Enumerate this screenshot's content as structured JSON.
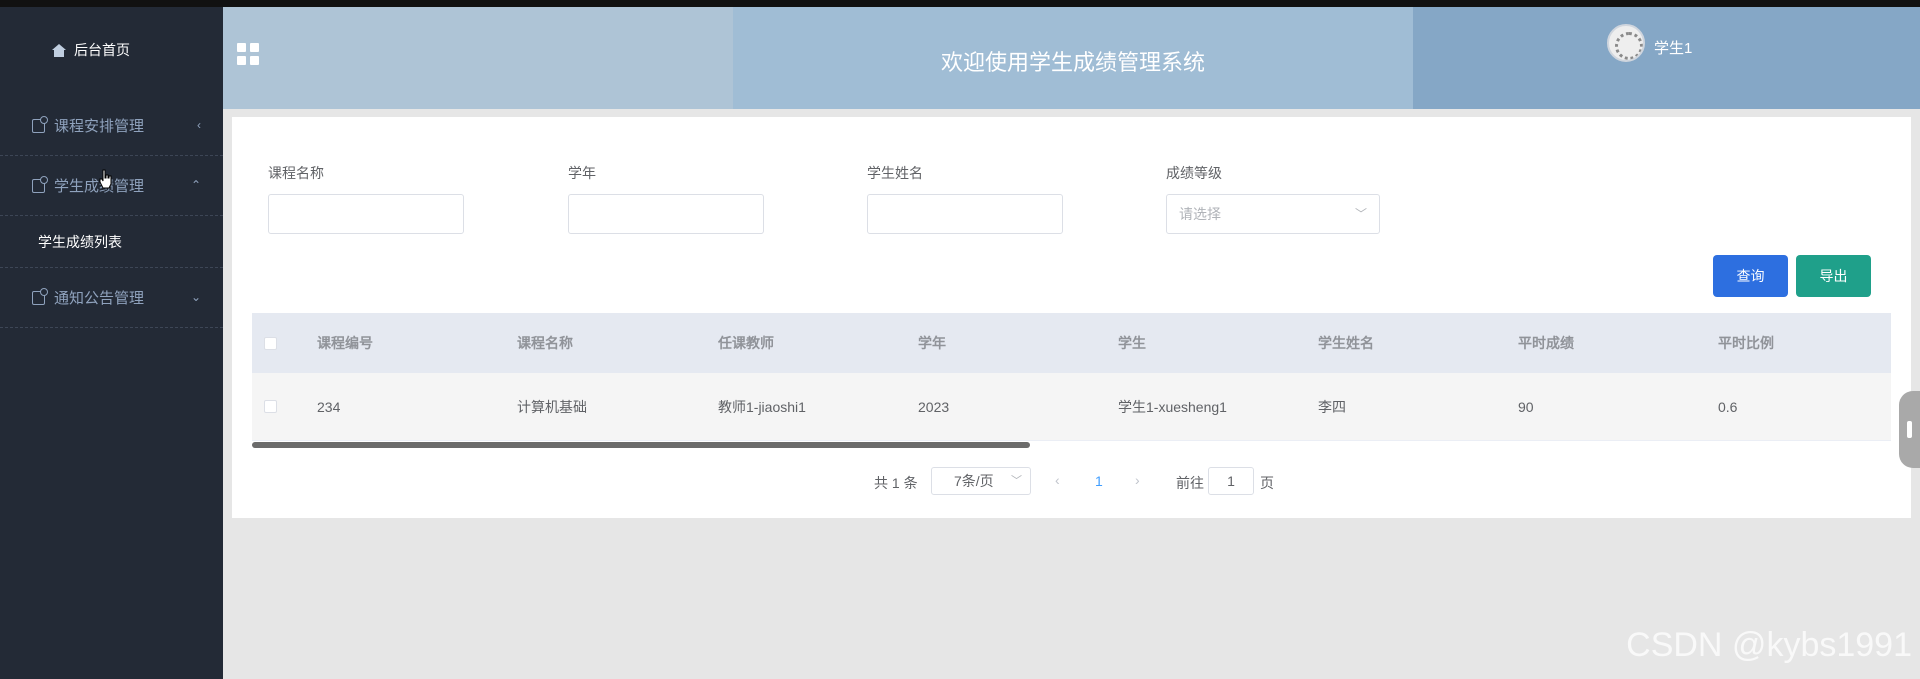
{
  "sidebar": {
    "home_label": "后台首页",
    "items": [
      {
        "label": "课程安排管理",
        "arrow": "‹"
      },
      {
        "label": "学生成绩管理",
        "arrow": "⌃"
      },
      {
        "label": "通知公告管理",
        "arrow": "⌄"
      }
    ],
    "sub_items": [
      "学生成绩列表"
    ]
  },
  "header": {
    "title": "欢迎使用学生成绩管理系统",
    "user": "学生1"
  },
  "search": {
    "fields": [
      {
        "label": "课程名称",
        "value": ""
      },
      {
        "label": "学年",
        "value": ""
      },
      {
        "label": "学生姓名",
        "value": ""
      },
      {
        "label": "成绩等级",
        "placeholder": "请选择"
      }
    ],
    "query_button": "查询",
    "export_button": "导出"
  },
  "table": {
    "columns": [
      "课程编号",
      "课程名称",
      "任课教师",
      "学年",
      "学生",
      "学生姓名",
      "平时成绩",
      "平时比例"
    ],
    "rows": [
      [
        "234",
        "计算机基础",
        "教师1-jiaoshi1",
        "2023",
        "学生1-xuesheng1",
        "李四",
        "90",
        "0.6"
      ]
    ]
  },
  "pagination": {
    "total": "共 1 条",
    "page_size": "7条/页",
    "current_page": "1",
    "goto_label": "前往",
    "goto_value": "1",
    "page_unit": "页"
  },
  "watermark": "CSDN @kybs1991"
}
